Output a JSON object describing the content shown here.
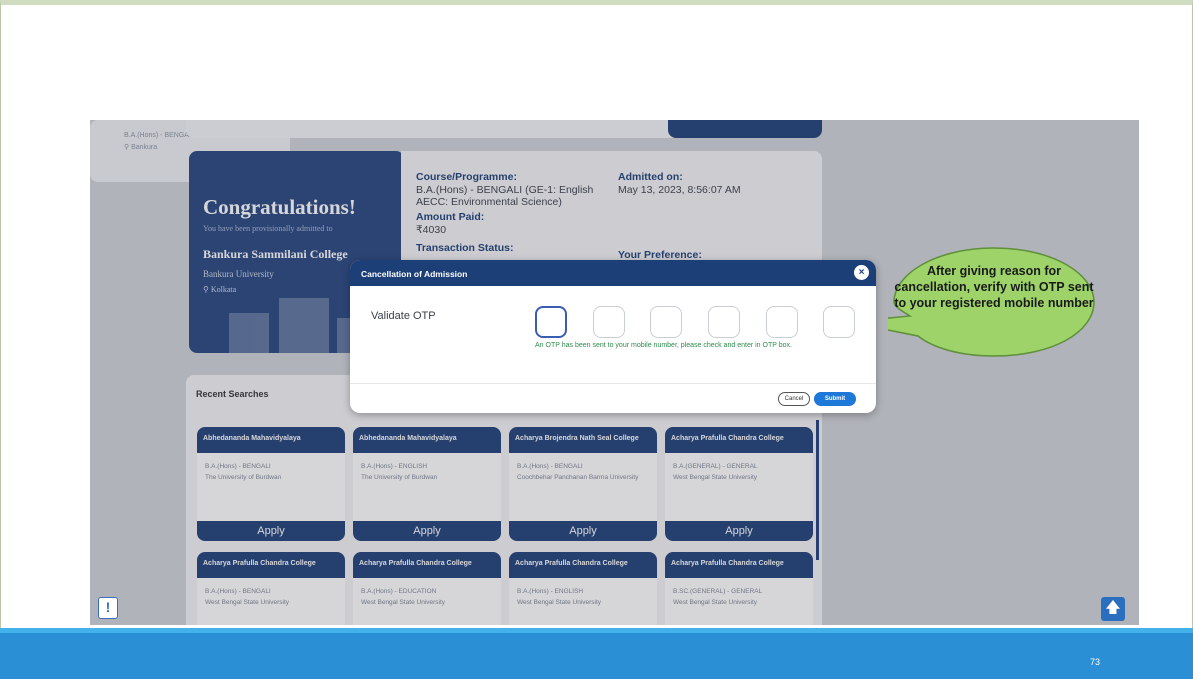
{
  "top_right_card": {
    "course": "B.A.(Hons) - BENGALI",
    "location": "Bankura"
  },
  "congrats": {
    "title": "Congratulations!",
    "subtitle": "You have been provisionally admitted to",
    "college": "Bankura Sammilani College",
    "university": "Bankura University",
    "location": "Kolkata"
  },
  "details": {
    "course_label": "Course/Programme:",
    "course_value": "B.A.(Hons) - BENGALI (GE-1: English AECC: Environmental Science)",
    "amount_label": "Amount Paid:",
    "amount_value": "₹4030",
    "transaction_label": "Transaction Status:",
    "admitted_label": "Admitted on:",
    "admitted_value": "May 13, 2023, 8:56:07 AM",
    "preference_label": "Your Preference:"
  },
  "recent": {
    "title": "Recent Searches",
    "apply_label": "Apply",
    "cards": [
      {
        "college": "Abhedananda Mahavidyalaya",
        "course": "B.A.(Hons) - BENGALI",
        "university": "The University of Burdwan"
      },
      {
        "college": "Abhedananda Mahavidyalaya",
        "course": "B.A.(Hons) - ENGLISH",
        "university": "The University of Burdwan"
      },
      {
        "college": "Acharya Brojendra Nath Seal College",
        "course": "B.A.(Hons) - BENGALI",
        "university": "Coochbehar Panchanan Barma University"
      },
      {
        "college": "Acharya Prafulla Chandra College",
        "course": "B.A.(GENERAL) - GENERAL",
        "university": "West Bengal State University"
      },
      {
        "college": "Acharya Prafulla Chandra College",
        "course": "B.A.(Hons) - BENGALI",
        "university": "West Bengal State University"
      },
      {
        "college": "Acharya Prafulla Chandra College",
        "course": "B.A.(Hons) - EDUCATION",
        "university": "West Bengal State University"
      },
      {
        "college": "Acharya Prafulla Chandra College",
        "course": "B.A.(Hons) - ENGLISH",
        "university": "West Bengal State University"
      },
      {
        "college": "Acharya Prafulla Chandra College",
        "course": "B.SC.(GENERAL) - GENERAL",
        "university": "West Bengal State University"
      }
    ]
  },
  "modal": {
    "title": "Cancellation of Admission",
    "otp_label": "Validate OTP",
    "otp_note": "An OTP has been sent to your mobile number, please check and enter in OTP box.",
    "cancel_label": "Cancel",
    "submit_label": "Submit",
    "close_icon": "×"
  },
  "callout": {
    "text": "After giving reason for cancellation, verify with OTP sent to your registered mobile number"
  },
  "slide": {
    "page_number": "73"
  },
  "icons": {
    "notice": "!",
    "scroll_top": "🡅"
  },
  "colors": {
    "navy": "#1d3f77",
    "accent_blue": "#1e78d8",
    "callout_green": "#9ed36a",
    "band_blue": "#2b8fd6"
  }
}
